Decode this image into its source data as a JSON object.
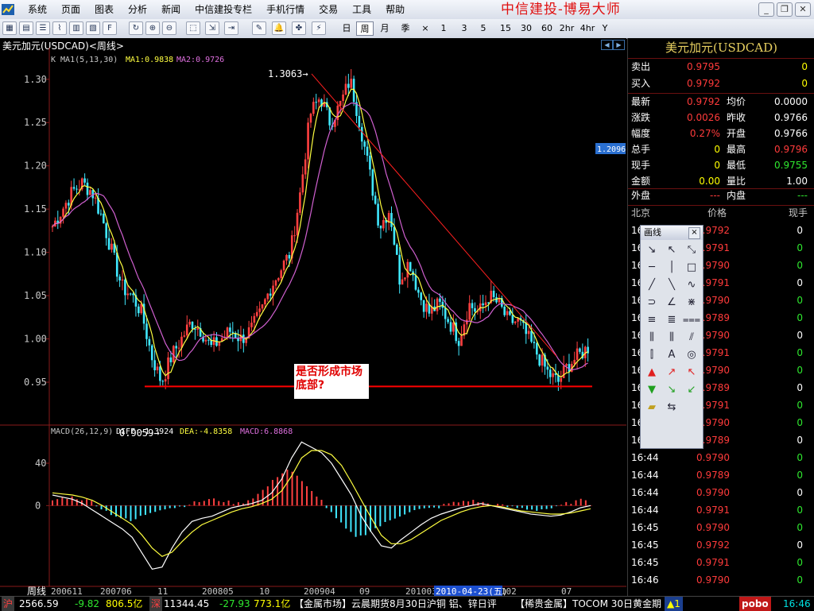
{
  "menubar": {
    "items": [
      "系统",
      "页面",
      "图表",
      "分析",
      "新闻",
      "中信建投专栏",
      "手机行情",
      "交易",
      "工具",
      "帮助"
    ],
    "brand": "中信建投-博易大师"
  },
  "toolbar": {
    "periods": [
      "日",
      "周",
      "月",
      "季",
      "×",
      "1",
      "3",
      "5",
      "15",
      "30",
      "60",
      "2hr",
      "4hr",
      "Y"
    ],
    "active_period": "周"
  },
  "chart_header": {
    "title": "美元加元(USDCAD)<周线>",
    "ma_label": "K  MA1(5,13,30)",
    "ma1_text": "MA1:0.9838",
    "ma2_text": "MA2:0.9726",
    "high_label": "1.3063",
    "low_label": "0.9059",
    "price_flag": "1.2096",
    "annotation": "是否形成市场底部?",
    "macd_label": "MACD(26,12,9)",
    "diff_text": "DIFF:-1.3924",
    "dea_text": "DEA:-4.8358",
    "macd_text": "MACD:6.8868",
    "x_axis_title": "周线",
    "selected_date": "2010-04-23(五)"
  },
  "chart_data": {
    "type": "candlestick",
    "price_axis": {
      "ticks": [
        "1.30",
        "1.25",
        "1.20",
        "1.15",
        "1.10",
        "1.05",
        "1.00",
        "0.95"
      ],
      "ylim": [
        0.905,
        1.32
      ]
    },
    "macd_axis": {
      "ticks": [
        "40",
        "0"
      ],
      "ylim": [
        -65,
        70
      ]
    },
    "x_ticks": [
      "200611",
      "200706",
      "11",
      "200805",
      "10",
      "200904",
      "09",
      "201003",
      "201102",
      "07"
    ],
    "close_path": [
      1.13,
      1.15,
      1.17,
      1.18,
      1.17,
      1.14,
      1.1,
      1.06,
      1.05,
      1.03,
      0.98,
      0.95,
      0.98,
      1.0,
      1.02,
      1.01,
      0.99,
      1.0,
      1.01,
      1.0,
      1.01,
      1.03,
      1.06,
      1.08,
      1.1,
      1.17,
      1.26,
      1.28,
      1.25,
      1.27,
      1.3,
      1.25,
      1.19,
      1.13,
      1.15,
      1.07,
      1.09,
      1.05,
      1.03,
      1.04,
      1.02,
      1.0,
      1.04,
      1.03,
      1.05,
      1.04,
      1.02,
      1.02,
      1.0,
      0.98,
      0.96,
      0.95,
      0.97,
      0.98,
      0.99
    ],
    "support_level": 0.945,
    "trendline": {
      "from_value": 1.3063,
      "to_value": 0.98
    },
    "macd_hist": [
      5,
      7,
      8,
      6,
      4,
      -3,
      -8,
      -12,
      -15,
      -10,
      -6,
      -3,
      -2,
      -1,
      2,
      4,
      6,
      5,
      3,
      2,
      6,
      12,
      20,
      30,
      35,
      25,
      15,
      8,
      -5,
      -15,
      -25,
      -30,
      -25,
      -20,
      -15,
      -10,
      -6,
      -4,
      -3,
      -2,
      2,
      3,
      5,
      4,
      2,
      1,
      -1,
      -2,
      -3,
      -4,
      -3,
      -2,
      2,
      4,
      6
    ],
    "diff_path": [
      10,
      8,
      6,
      2,
      -4,
      -10,
      -16,
      -22,
      -30,
      -45,
      -60,
      -58,
      -40,
      -25,
      -15,
      -12,
      -10,
      -6,
      -2,
      0,
      2,
      5,
      12,
      25,
      45,
      60,
      55,
      50,
      40,
      25,
      10,
      -10,
      -25,
      -38,
      -40,
      -32,
      -25,
      -18,
      -12,
      -8,
      -5,
      -2,
      0,
      2,
      0,
      -2,
      -4,
      -6,
      -8,
      -9,
      -10,
      -9,
      -6,
      -2,
      0
    ],
    "dea_path": [
      12,
      11,
      10,
      8,
      5,
      0,
      -6,
      -12,
      -18,
      -28,
      -40,
      -48,
      -44,
      -34,
      -25,
      -18,
      -14,
      -10,
      -6,
      -3,
      -1,
      2,
      6,
      14,
      28,
      45,
      52,
      52,
      48,
      38,
      22,
      5,
      -12,
      -28,
      -36,
      -36,
      -32,
      -26,
      -20,
      -14,
      -10,
      -6,
      -3,
      -1,
      0,
      -1,
      -3,
      -5,
      -6,
      -7,
      -8,
      -8,
      -7,
      -5,
      -3
    ],
    "colors": {
      "up": "#ff4040",
      "down": "#40e8ff",
      "ma1": "#ffff40",
      "ma2": "#d060d0",
      "level": "#ff0000"
    }
  },
  "quote_panel": {
    "title": "美元加元(USDCAD)",
    "sell_label": "卖出",
    "sell_price": "0.9795",
    "sell_vol": "0",
    "buy_label": "买入",
    "buy_price": "0.9792",
    "buy_vol": "0",
    "rows": [
      {
        "l1": "最新",
        "v1": "0.9792",
        "c1": "#ff3b3b",
        "l2": "均价",
        "v2": "0.0000",
        "c2": "#ffffff"
      },
      {
        "l1": "涨跌",
        "v1": "0.0026",
        "c1": "#ff3b3b",
        "l2": "昨收",
        "v2": "0.9766",
        "c2": "#ffffff"
      },
      {
        "l1": "幅度",
        "v1": "0.27%",
        "c1": "#ff3b3b",
        "l2": "开盘",
        "v2": "0.9766",
        "c2": "#ffffff"
      },
      {
        "l1": "总手",
        "v1": "0",
        "c1": "#ffff00",
        "l2": "最高",
        "v2": "0.9796",
        "c2": "#ff3b3b"
      },
      {
        "l1": "现手",
        "v1": "0",
        "c1": "#ffff00",
        "l2": "最低",
        "v2": "0.9755",
        "c2": "#2fe82f"
      },
      {
        "l1": "金额",
        "v1": "0.00",
        "c1": "#ffff00",
        "l2": "量比",
        "v2": "1.00",
        "c2": "#ffffff"
      }
    ],
    "outer_label": "外盘",
    "outer_val": "---",
    "inner_label": "内盘",
    "inner_val": "---",
    "ticks_header": {
      "time": "北京",
      "price": "价格",
      "vol": "现手"
    },
    "ticks": [
      {
        "time": "16:44",
        "price": "0.9792",
        "vol": "0"
      },
      {
        "time": "16:44",
        "price": "0.9791",
        "vol": "0"
      },
      {
        "time": "16:44",
        "price": "0.9790",
        "vol": "0"
      },
      {
        "time": "16:44",
        "price": "0.9791",
        "vol": "0"
      },
      {
        "time": "16:44",
        "price": "0.9790",
        "vol": "0"
      },
      {
        "time": "16:44",
        "price": "0.9789",
        "vol": "0"
      },
      {
        "time": "16:44",
        "price": "0.9790",
        "vol": "0"
      },
      {
        "time": "16:44",
        "price": "0.9791",
        "vol": "0"
      },
      {
        "time": "16:44",
        "price": "0.9790",
        "vol": "0"
      },
      {
        "time": "16:44",
        "price": "0.9789",
        "vol": "0"
      },
      {
        "time": "16:44",
        "price": "0.9791",
        "vol": "0"
      },
      {
        "time": "16:44",
        "price": "0.9790",
        "vol": "0"
      },
      {
        "time": "16:44",
        "price": "0.9789",
        "vol": "0"
      },
      {
        "time": "16:44",
        "price": "0.9790",
        "vol": "0"
      },
      {
        "time": "16:44",
        "price": "0.9789",
        "vol": "0"
      },
      {
        "time": "16:44",
        "price": "0.9790",
        "vol": "0"
      },
      {
        "time": "16:44",
        "price": "0.9791",
        "vol": "0"
      },
      {
        "time": "16:45",
        "price": "0.9790",
        "vol": "0"
      },
      {
        "time": "16:45",
        "price": "0.9792",
        "vol": "0"
      },
      {
        "time": "16:45",
        "price": "0.9791",
        "vol": "0"
      },
      {
        "time": "16:46",
        "price": "0.9790",
        "vol": "0"
      }
    ]
  },
  "drawing_palette": {
    "title": "画线",
    "close": "×",
    "tools": [
      "↘",
      "↖",
      "⤡",
      "─",
      "│",
      "□",
      "╱",
      "╲",
      "∿",
      "⊃",
      "∠",
      "⋇",
      "≡",
      "≣",
      "⩶",
      "⫼",
      "⫼",
      "⫽",
      "⫿",
      "A",
      "◎",
      "▲",
      "↗",
      "↖",
      "▼",
      "↘",
      "↙",
      "▰",
      "⇆"
    ]
  },
  "statusbar": {
    "sh_label": "沪",
    "sh_index": "2566.59",
    "sh_change": "-9.82",
    "sh_amount": "806.5亿",
    "sz_label": "深",
    "sz_index": "11344.45",
    "sz_change": "-27.93",
    "sz_amount": "773.1亿",
    "news1": "【金属市场】云晨期货8月30日沪铜 铝、锌日评",
    "news2": "【稀贵金属】TOCOM 30日黄金期",
    "alert": "▲1",
    "pobo": "pobo",
    "time": "16:46"
  }
}
